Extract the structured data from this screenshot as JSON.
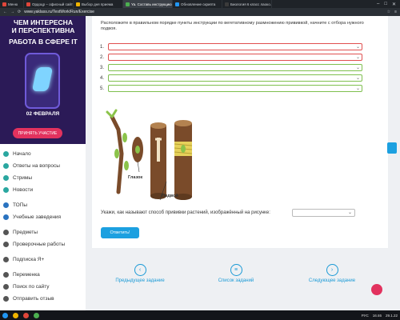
{
  "browser": {
    "tabs": [
      {
        "label": "Меню",
        "active": false,
        "color": "#e0463a"
      },
      {
        "label": "Ордоцр – офисный сайт Ор...",
        "active": false,
        "color": "#e0463a"
      },
      {
        "label": "Выбор дня приема",
        "active": false,
        "color": "#f0b400"
      },
      {
        "label": "Ya. Составь инструкцию...",
        "active": true,
        "color": "#4caf50"
      },
      {
        "label": "Обновление скрипта",
        "active": false,
        "color": "#2196f3"
      },
      {
        "label": "Биология 6 класс лаоко...",
        "active": false,
        "color": "#3b3b3b"
      }
    ],
    "url": "www.yaklass.ru/TestWork/Run/Exercise"
  },
  "promo": {
    "title_line1": "ЧЕМ ИНТЕРЕСНА",
    "title_line2": "И ПЕРСПЕКТИВНА",
    "title_line3": "РАБОТА В СФЕРЕ IT",
    "date": "02 ФЕВРАЛЯ",
    "button": "ПРИНЯТЬ УЧАСТИЕ"
  },
  "nav": {
    "items": [
      {
        "label": "Начало",
        "icon": "home-icon",
        "color": "#2aa7a0"
      },
      {
        "label": "Ответы на вопросы",
        "icon": "question-icon",
        "color": "#2aa7a0"
      },
      {
        "label": "Стримы",
        "icon": "stream-icon",
        "color": "#2aa7a0"
      },
      {
        "label": "Новости",
        "icon": "news-icon",
        "color": "#2aa7a0"
      },
      {
        "label": "ТОПы",
        "icon": "trophy-icon",
        "color": "#2a73c0"
      },
      {
        "label": "Учебные заведения",
        "icon": "school-icon",
        "color": "#2a73c0"
      },
      {
        "label": "Предметы",
        "icon": "subjects-icon",
        "color": "#555555"
      },
      {
        "label": "Проверочные работы",
        "icon": "tests-icon",
        "color": "#555555"
      },
      {
        "label": "Подписка Я+",
        "icon": "subscription-icon",
        "color": "#555555"
      },
      {
        "label": "Переменка",
        "icon": "break-icon",
        "color": "#555555"
      },
      {
        "label": "Поиск по сайту",
        "icon": "search-icon",
        "color": "#555555"
      },
      {
        "label": "Отправить отзыв",
        "icon": "feedback-icon",
        "color": "#555555"
      }
    ]
  },
  "task": {
    "instruction": "Расположите в правильном порядке пункты инструкции по вегетативному размножению прививкой, начните с отбора нужного подвоя.",
    "rows": [
      {
        "num": "1.",
        "state": "red"
      },
      {
        "num": "2.",
        "state": "red"
      },
      {
        "num": "3.",
        "state": "green"
      },
      {
        "num": "4.",
        "state": "green"
      },
      {
        "num": "5.",
        "state": "green"
      }
    ],
    "label_glazok": "Глазок",
    "label_podvoy": "Подвой",
    "question2": "Укажи, как называют способ прививки растений, изображённый на рисунке:",
    "submit": "Ответить!"
  },
  "pager": {
    "prev": "Предыдущее задание",
    "list": "Список заданий",
    "next": "Следующее задание"
  },
  "taskbar": {
    "lang": "РУС",
    "time": "16:46",
    "date": "29.1.22"
  }
}
